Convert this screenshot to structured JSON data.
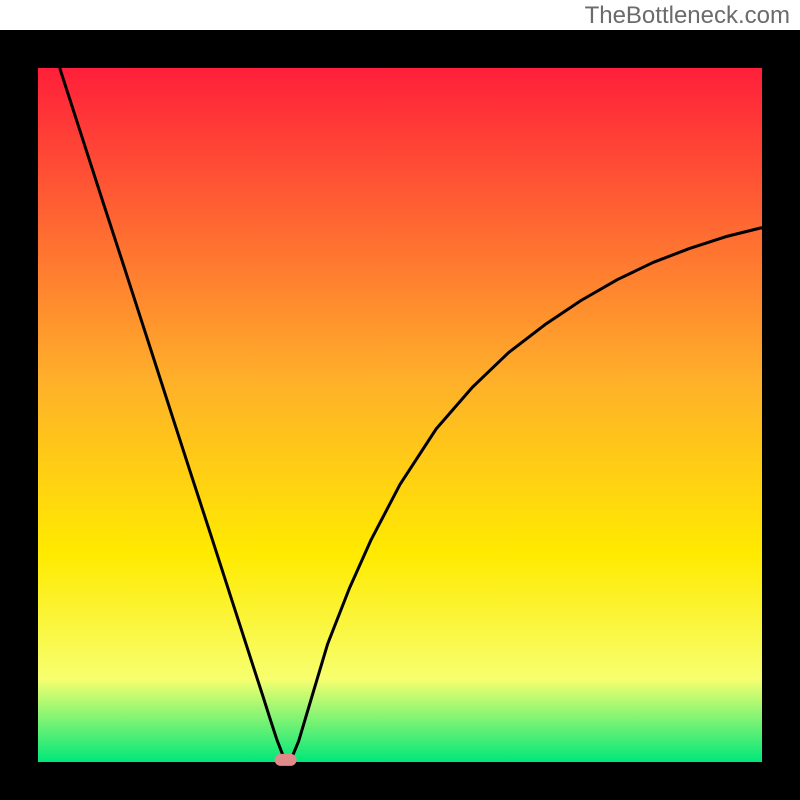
{
  "watermark": "TheBottleneck.com",
  "colors": {
    "frame": "#000000",
    "gradient_top": "#ff1f3a",
    "gradient_mid1": "#ffb02a",
    "gradient_mid2": "#ffea00",
    "gradient_mid3": "#f7ff6e",
    "gradient_bottom": "#00e77a",
    "curve": "#000000",
    "marker": "#e08a8a"
  },
  "chart_data": {
    "type": "line",
    "title": "",
    "xlabel": "",
    "ylabel": "",
    "xlim": [
      0,
      100
    ],
    "ylim": [
      0,
      100
    ],
    "x": [
      3,
      6,
      9,
      12,
      15,
      18,
      21,
      24,
      27,
      30,
      31,
      32,
      33,
      34,
      34.5,
      35,
      36,
      38,
      40,
      43,
      46,
      50,
      55,
      60,
      65,
      70,
      75,
      80,
      85,
      90,
      95,
      100
    ],
    "y": [
      100,
      90.3,
      80.6,
      71.0,
      61.3,
      51.6,
      41.9,
      32.3,
      22.6,
      12.9,
      9.7,
      6.4,
      3.2,
      0.5,
      0.2,
      0.5,
      3.0,
      10.0,
      17.0,
      25.0,
      32.0,
      40.0,
      48.0,
      54.0,
      59.0,
      63.0,
      66.5,
      69.5,
      72.0,
      74.0,
      75.7,
      77.0
    ],
    "marker": {
      "x": 34.2,
      "y": 0.3
    }
  }
}
